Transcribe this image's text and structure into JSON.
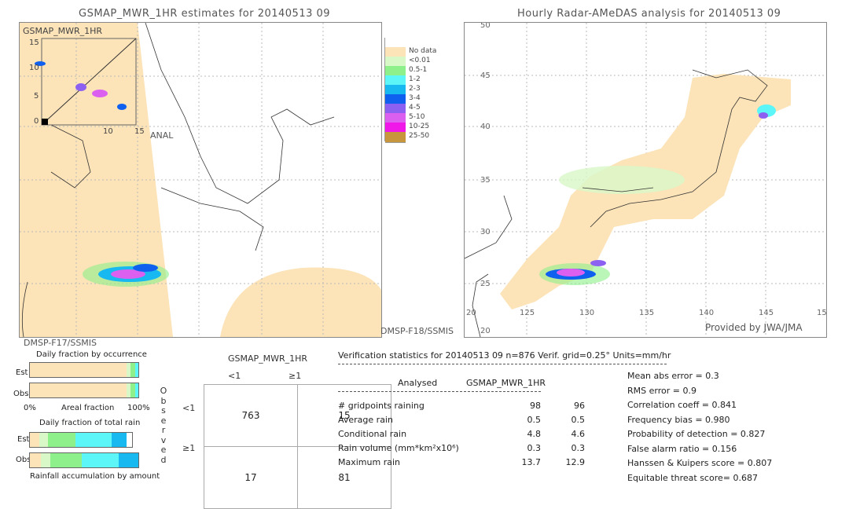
{
  "left_map": {
    "title": "GSMAP_MWR_1HR estimates for 20140513 09",
    "inset_label": "GSMAP_MWR_1HR",
    "inset_xlabel": "ANAL",
    "inset_ticks": [
      "0",
      "5",
      "10",
      "15"
    ],
    "satellite_bottom_right": "DMSP-F18/SSMIS",
    "satellite_bottom_left": "DMSP-F17/SSMIS"
  },
  "right_map": {
    "title": "Hourly Radar-AMeDAS analysis for 20140513 09",
    "lat_labels": [
      "50",
      "45",
      "40",
      "35",
      "30",
      "25",
      "20"
    ],
    "lon_labels": [
      "20",
      "125",
      "130",
      "135",
      "140",
      "145",
      "15"
    ],
    "credit": "Provided by JWA/JMA"
  },
  "legend": [
    {
      "label": "",
      "color": "#ffffff"
    },
    {
      "label": "No data",
      "color": "#fce3b8"
    },
    {
      "label": "<0.01",
      "color": "#d8f8c8"
    },
    {
      "label": "0.5-1",
      "color": "#8ef08a"
    },
    {
      "label": "1-2",
      "color": "#5cf6f8"
    },
    {
      "label": "2-3",
      "color": "#18b8f0"
    },
    {
      "label": "3-4",
      "color": "#1060f0"
    },
    {
      "label": "4-5",
      "color": "#8c60f0"
    },
    {
      "label": "5-10",
      "color": "#dc60f0"
    },
    {
      "label": "10-25",
      "color": "#f018e8"
    },
    {
      "label": "25-50",
      "color": "#c8963c"
    }
  ],
  "occurrence": {
    "title": "Daily fraction by occurrence",
    "est_label": "Est",
    "obs_label": "Obs",
    "axis_left": "0%",
    "axis_mid": "Areal fraction",
    "axis_right": "100%",
    "est": [
      {
        "pct": 89,
        "color": "#fce3b8"
      },
      {
        "pct": 4,
        "color": "#d8f8c8"
      },
      {
        "pct": 4,
        "color": "#8ef08a"
      },
      {
        "pct": 3,
        "color": "#5cf6f8"
      }
    ],
    "obs": [
      {
        "pct": 89,
        "color": "#fce3b8"
      },
      {
        "pct": 4,
        "color": "#d8f8c8"
      },
      {
        "pct": 4,
        "color": "#8ef08a"
      },
      {
        "pct": 3,
        "color": "#5cf6f8"
      }
    ]
  },
  "total_rain": {
    "title": "Daily fraction of total rain",
    "est_label": "Est",
    "obs_label": "Obs",
    "footer": "Rainfall accumulation by amount",
    "est": [
      {
        "pct": 9,
        "color": "#fce3b8"
      },
      {
        "pct": 9,
        "color": "#d8f8c8"
      },
      {
        "pct": 27,
        "color": "#8ef08a"
      },
      {
        "pct": 35,
        "color": "#5cf6f8"
      },
      {
        "pct": 15,
        "color": "#18b8f0"
      }
    ],
    "obs": [
      {
        "pct": 10,
        "color": "#fce3b8"
      },
      {
        "pct": 9,
        "color": "#d8f8c8"
      },
      {
        "pct": 29,
        "color": "#8ef08a"
      },
      {
        "pct": 34,
        "color": "#5cf6f8"
      },
      {
        "pct": 18,
        "color": "#18b8f0"
      }
    ]
  },
  "contingency": {
    "header": "GSMAP_MWR_1HR",
    "col_lt": "<1",
    "col_ge": "≥1",
    "row_lt": "<1",
    "row_ge": "≥1",
    "observed_label": [
      "O",
      "b",
      "s",
      "e",
      "r",
      "v",
      "e",
      "d"
    ],
    "cells": [
      [
        "763",
        "15"
      ],
      [
        "17",
        "81"
      ]
    ]
  },
  "stats": {
    "header": "Verification statistics for 20140513 09   n=876   Verif. grid=0.25°   Units=mm/hr",
    "col_analysed": "Analysed",
    "col_est": "GSMAP_MWR_1HR",
    "rows": [
      {
        "label": "# gridpoints raining",
        "a": "98",
        "e": "96"
      },
      {
        "label": "Average rain",
        "a": "0.5",
        "e": "0.5"
      },
      {
        "label": "Conditional rain",
        "a": "4.8",
        "e": "4.6"
      },
      {
        "label": "Rain volume (mm*km²x10⁶)",
        "a": "0.3",
        "e": "0.3"
      },
      {
        "label": "Maximum rain",
        "a": "13.7",
        "e": "12.9"
      }
    ],
    "scores": [
      "Mean abs error = 0.3",
      "RMS error = 0.9",
      "Correlation coeff = 0.841",
      "Frequency bias = 0.980",
      "Probability of detection = 0.827",
      "False alarm ratio = 0.156",
      "Hanssen & Kuipers score = 0.807",
      "Equitable threat score= 0.687"
    ]
  }
}
